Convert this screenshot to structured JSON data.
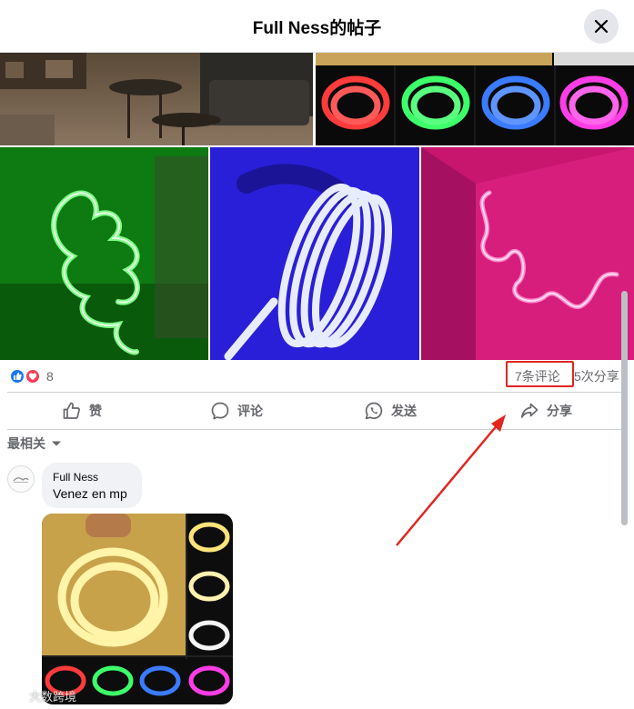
{
  "header": {
    "title": "Full Ness的帖子"
  },
  "icons": {
    "close": "close-icon",
    "like": "thumbs-up-icon",
    "comment": "speech-bubble-icon",
    "send": "whatsapp-icon",
    "share": "share-arrow-icon",
    "sort": "chevron-down-icon"
  },
  "colors": {
    "facebook_blue": "#1877f2",
    "love_red": "#f33e58",
    "highlight_red": "#e0261f"
  },
  "reactions": {
    "count": "8",
    "comments": "7条评论",
    "shares": "5次分享"
  },
  "actions": {
    "like_label": "赞",
    "comment_label": "评论",
    "send_label": "发送",
    "share_label": "分享"
  },
  "sort": {
    "label": "最相关"
  },
  "comment": {
    "author": "Full Ness",
    "text": "Venez en mp"
  },
  "watermark": {
    "text": "大数跨境"
  }
}
